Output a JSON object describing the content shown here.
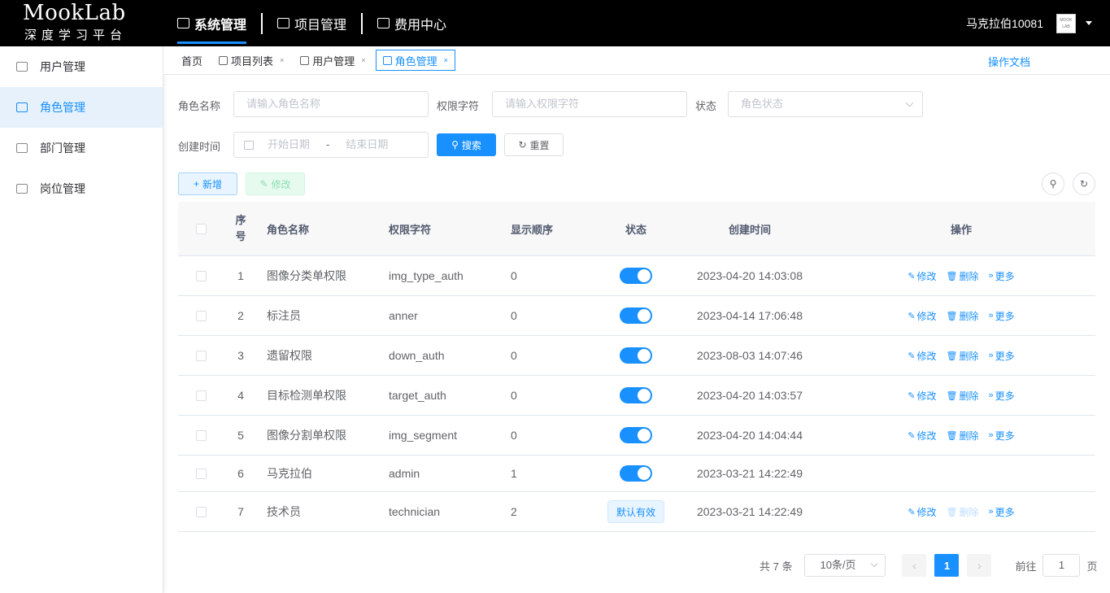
{
  "brand": {
    "name": "MookLab",
    "subtitle": "深度学习平台"
  },
  "topnav": [
    {
      "label": "系统管理",
      "icon": "monitor-icon",
      "active": true
    },
    {
      "label": "项目管理",
      "icon": "robot-icon",
      "active": false
    },
    {
      "label": "费用中心",
      "icon": "wallet-icon",
      "active": false
    }
  ],
  "user": {
    "name": "马克拉伯10081"
  },
  "sidebar": [
    {
      "label": "用户管理",
      "icon": "user-icon"
    },
    {
      "label": "角色管理",
      "icon": "role-icon",
      "active": true
    },
    {
      "label": "部门管理",
      "icon": "tree-icon"
    },
    {
      "label": "岗位管理",
      "icon": "post-icon"
    }
  ],
  "tabs": [
    {
      "label": "首页"
    },
    {
      "label": "项目列表",
      "close": "×"
    },
    {
      "label": "用户管理",
      "close": "×"
    },
    {
      "label": "角色管理",
      "close": "×",
      "active": true
    }
  ],
  "doc_link": "操作文档",
  "filters": {
    "role_name_label": "角色名称",
    "role_name_placeholder": "请输入角色名称",
    "role_key_label": "权限字符",
    "role_key_placeholder": "请输入权限字符",
    "status_label": "状态",
    "status_placeholder": "角色状态",
    "date_label": "创建时间",
    "start_placeholder": "开始日期",
    "date_sep": "-",
    "end_placeholder": "结束日期",
    "search_label": "搜索",
    "reset_label": "重置"
  },
  "toolbar": {
    "add_label": "新增",
    "edit_label": "修改"
  },
  "table": {
    "headers": {
      "idx_1": "序",
      "idx_2": "号",
      "name": "角色名称",
      "key": "权限字符",
      "order": "显示顺序",
      "status": "状态",
      "time": "创建时间",
      "ops": "操作"
    },
    "ops_labels": {
      "edit": "修改",
      "delete": "删除",
      "more": "更多"
    },
    "rows": [
      {
        "idx": "1",
        "name": "图像分类单权限",
        "key": "img_type_auth",
        "order": "0",
        "status": "on",
        "time": "2023-04-20 14:03:08",
        "ops": true,
        "delete_enabled": true
      },
      {
        "idx": "2",
        "name": "标注员",
        "key": "anner",
        "order": "0",
        "status": "on",
        "time": "2023-04-14 17:06:48",
        "ops": true,
        "delete_enabled": true
      },
      {
        "idx": "3",
        "name": "遗留权限",
        "key": "down_auth",
        "order": "0",
        "status": "on",
        "time": "2023-08-03 14:07:46",
        "ops": true,
        "delete_enabled": true
      },
      {
        "idx": "4",
        "name": "目标检测单权限",
        "key": "target_auth",
        "order": "0",
        "status": "on",
        "time": "2023-04-20 14:03:57",
        "ops": true,
        "delete_enabled": true
      },
      {
        "idx": "5",
        "name": "图像分割单权限",
        "key": "img_segment",
        "order": "0",
        "status": "on",
        "time": "2023-04-20 14:04:44",
        "ops": true,
        "delete_enabled": true
      },
      {
        "idx": "6",
        "name": "马克拉伯",
        "key": "admin",
        "order": "1",
        "status": "on",
        "time": "2023-03-21 14:22:49",
        "ops": false
      },
      {
        "idx": "7",
        "name": "技术员",
        "key": "technician",
        "order": "2",
        "status": "tag",
        "status_text": "默认有效",
        "time": "2023-03-21 14:22:49",
        "ops": true,
        "delete_enabled": false
      }
    ]
  },
  "pagination": {
    "total": "共 7 条",
    "page_size": "10条/页",
    "current": "1",
    "goto_prefix": "前往",
    "goto_value": "1",
    "goto_suffix": "页"
  }
}
